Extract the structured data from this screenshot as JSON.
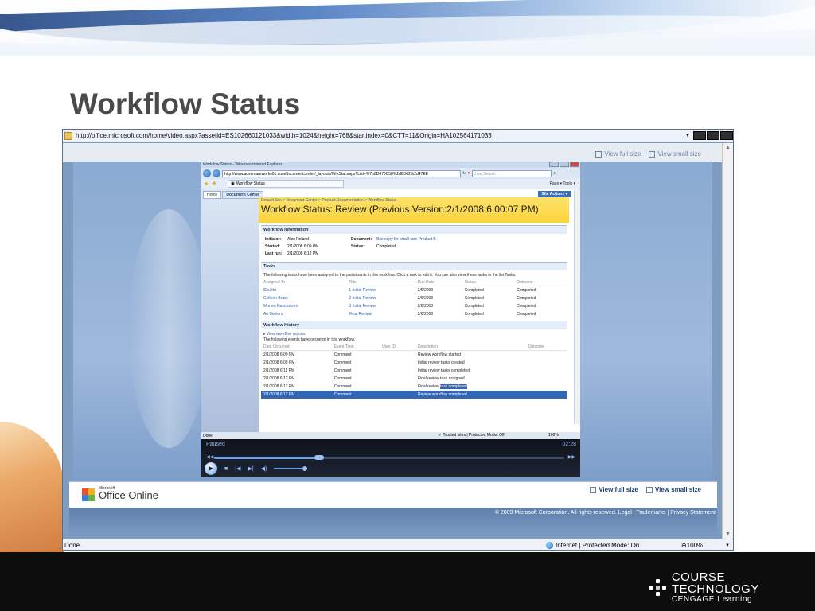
{
  "slide": {
    "title": "Workflow Status",
    "footer_brand_top": "COURSE TECHNOLOGY",
    "footer_brand_bottom": "CENGAGE Learning"
  },
  "outer_browser": {
    "url": "http://office.microsoft.com/home/video.aspx?assetid=ES102660121033&width=1024&height=768&startindex=0&CTT=11&Origin=HA102564171033",
    "view_full_size": "View full size",
    "view_small_size": "View small size",
    "status_done": "Done",
    "zone": "Internet | Protected Mode: On",
    "zoom": "100%",
    "copyright": "© 2009 Microsoft Corporation. All rights reserved. Legal | Trademarks | Privacy Statement",
    "office_logo_small": "Microsoft",
    "office_logo": "Office Online"
  },
  "inner_browser": {
    "title": "Workflow Status - Windows Internet Explorer",
    "url": "http://www.adventureworks01.com/documentcenter/_layouts/WrkStat.aspx?List=%7b6D470C58%2d8D62%2d47EE",
    "search_placeholder": "Live Search",
    "tab_title": "Workflow Status",
    "tools_text": "Page ▾  Tools ▾",
    "status_done": "Done",
    "zone": "Trusted sites | Protected Mode: Off",
    "zoom": "100%"
  },
  "sharepoint": {
    "tab_home": "Home",
    "tab_doc_center": "Document Center",
    "site_actions": "Site Actions ▾",
    "breadcrumb": "Default Site > Document Center > Product Documentation > Workflow Status",
    "page_title": "Workflow Status: Review (Previous Version:2/1/2008 6:00:07 PM)",
    "info": {
      "header": "Workflow Information",
      "initiator_label": "Initiator:",
      "initiator": "Alex Roland",
      "started_label": "Started:",
      "started": "2/1/2008 6:09 PM",
      "last_run_label": "Last run:",
      "last_run": "2/1/2008 6:12 PM",
      "document_label": "Document:",
      "document": "Box copy for small-size Product B",
      "status_label": "Status:",
      "status": "Completed"
    },
    "tasks": {
      "header": "Tasks",
      "desc": "The following tasks have been assigned to the participants in this workflow. Click a task to edit it. You can also view these tasks in the list Tasks.",
      "columns": [
        "Assigned To",
        "Title",
        "Due Date",
        "Status",
        "Outcome"
      ],
      "rows": [
        [
          "Shu Ito",
          "1 Initial Review",
          "2/6/2008",
          "Completed",
          "Completed"
        ],
        [
          "Colleen Bracy",
          "2 Initial Review",
          "2/6/2008",
          "Completed",
          "Completed"
        ],
        [
          "Morten Rasmussen",
          "3 Initial Review",
          "2/6/2008",
          "Completed",
          "Completed"
        ],
        [
          "Ari Bixhorn",
          "Final Review",
          "2/6/2008",
          "Completed",
          "Completed"
        ]
      ]
    },
    "history": {
      "header": "Workflow History",
      "view_reports": "View workflow reports",
      "desc": "The following events have occurred in this workflow.",
      "columns": [
        "Date Occurred",
        "Event Type",
        "User ID",
        "Description",
        "Outcome"
      ],
      "rows": [
        [
          "2/1/2008 6:09 PM",
          "Comment",
          "",
          "Review workflow started",
          ""
        ],
        [
          "2/1/2008 6:09 PM",
          "Comment",
          "",
          "Initial review tasks created",
          ""
        ],
        [
          "2/1/2008 6:11 PM",
          "Comment",
          "",
          "Initial review tasks completed",
          ""
        ],
        [
          "2/1/2008 6:12 PM",
          "Comment",
          "",
          "Final review task assigned",
          ""
        ],
        [
          "2/1/2008 6:12 PM",
          "Comment",
          "",
          "Final review task completed",
          ""
        ],
        [
          "2/1/2008 6:12 PM",
          "Comment",
          "",
          "Review workflow completed",
          ""
        ]
      ]
    }
  },
  "player": {
    "state": "Paused",
    "time": "02:28",
    "progress": 0.3
  }
}
